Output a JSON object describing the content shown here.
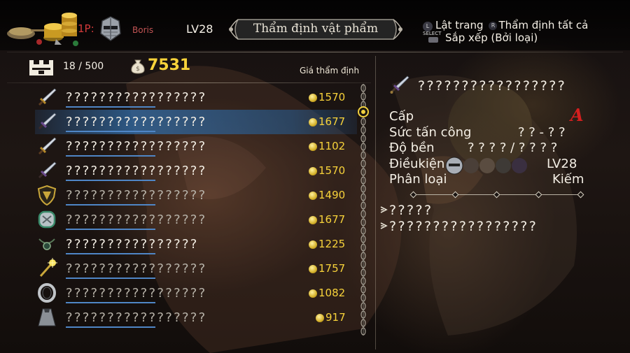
{
  "header": {
    "player_tag": "1P:",
    "player_name": "Boris",
    "player_level": "LV28",
    "screen_title": "Thẩm định vật phẩm",
    "hints": [
      {
        "button": "L",
        "label": "Lật trang"
      },
      {
        "button": "R",
        "label": "Thẩm định tất cả"
      },
      {
        "button": "SELECT",
        "label": "Sắp xếp (Bởi loại)"
      }
    ]
  },
  "inventory": {
    "count": "18 / 500",
    "gold": "7531",
    "price_header": "Giá thẩm định",
    "items": [
      {
        "icon": "sword-icon",
        "name": "?????????????????",
        "price": "1570",
        "bright": true
      },
      {
        "icon": "dagger-icon",
        "name": "?????????????????",
        "price": "1677",
        "bright": true,
        "selected": true
      },
      {
        "icon": "sword-icon",
        "name": "?????????????????",
        "price": "1102",
        "bright": true
      },
      {
        "icon": "dagger-icon",
        "name": "?????????????????",
        "price": "1570",
        "bright": true
      },
      {
        "icon": "shield-icon",
        "name": "?????????????????",
        "price": "1490",
        "bright": false
      },
      {
        "icon": "gauntlet-icon",
        "name": "?????????????????",
        "price": "1677",
        "bright": false
      },
      {
        "icon": "amulet-icon",
        "name": "????????????????",
        "price": "1225",
        "bright": true
      },
      {
        "icon": "staff-icon",
        "name": "?????????????????",
        "price": "1757",
        "bright": false
      },
      {
        "icon": "ring-icon",
        "name": "?????????????????",
        "price": "1082",
        "bright": false
      },
      {
        "icon": "cloak-icon",
        "name": "?????????????????",
        "price": "917",
        "bright": false
      }
    ]
  },
  "detail": {
    "icon": "dagger-icon",
    "name": "?????????????????",
    "stats": {
      "grade_label": "Cấp",
      "grade_value": "A",
      "attack_label": "Sức tấn công",
      "attack_value": "? ? - ? ?",
      "durability_label": "Độ bền",
      "durability_value": "? ? ? ? / ? ? ? ?",
      "requirement_label": "Điềukiện",
      "requirement_value": "LV28",
      "category_label": "Phân loại",
      "category_value": "Kiếm"
    },
    "effects": [
      "?????",
      "?????????????????"
    ]
  },
  "colors": {
    "gold": "#f7d23a",
    "selection": "#3a78b4",
    "player_red": "#d23a3a",
    "grade_red": "#d51f1f",
    "underline_blue": "#4f86c6"
  }
}
